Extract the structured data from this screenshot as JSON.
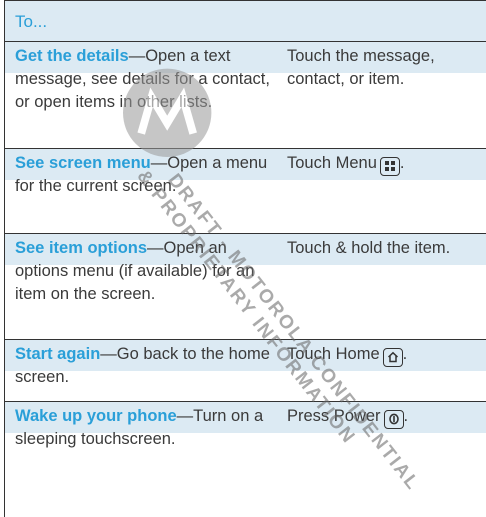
{
  "header": {
    "label": "To..."
  },
  "rows": [
    {
      "term": "Get the details",
      "desc": "—Open a text message, see details for a contact, or open items in other lists.",
      "action": "Touch the message, contact, or item.",
      "key": ""
    },
    {
      "term": "See screen menu",
      "desc": "—Open a menu for the current screen.",
      "action": "Touch Menu",
      "key": "menu-key-icon",
      "suffix": "."
    },
    {
      "term": "See item options",
      "desc": "—Open an options menu (if available) for an item on the screen.",
      "action": "Touch & hold the item.",
      "key": ""
    },
    {
      "term": "Start again",
      "desc": "—Go back to the home screen.",
      "action": "Touch Home",
      "key": "home-key-icon",
      "suffix": "."
    },
    {
      "term": "Wake up your phone",
      "desc": "—Turn on a sleeping touchscreen.",
      "action": "Press Power",
      "key": "power-key-icon",
      "suffix": "."
    }
  ],
  "watermark": {
    "line1": "DRAFT - MOTOROLA CONFIDENTIAL",
    "line2": "& PROPRIETARY INFORMATION"
  },
  "colors": {
    "accent": "#2a9fd8",
    "shade": "#dceaf3",
    "border": "#333333"
  }
}
